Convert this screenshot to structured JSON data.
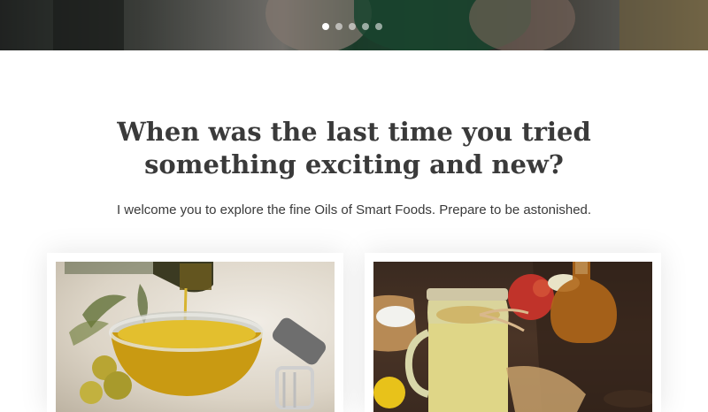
{
  "hero": {
    "carousel": {
      "slide_count": 5,
      "active_index": 0
    }
  },
  "main": {
    "headline_line1": "When was the last time you tried",
    "headline_line2": "something exciting and new?",
    "intro": "I welcome you to explore the fine Oils of Smart Foods. Prepare to be astonished."
  },
  "cards": [
    {
      "image": "olive-oil-bowl-image"
    },
    {
      "image": "apple-cider-jar-image"
    }
  ],
  "colors": {
    "heading_text": "#3a3a3a",
    "body_text": "#3a3a3a",
    "page_background": "#ffffff"
  }
}
